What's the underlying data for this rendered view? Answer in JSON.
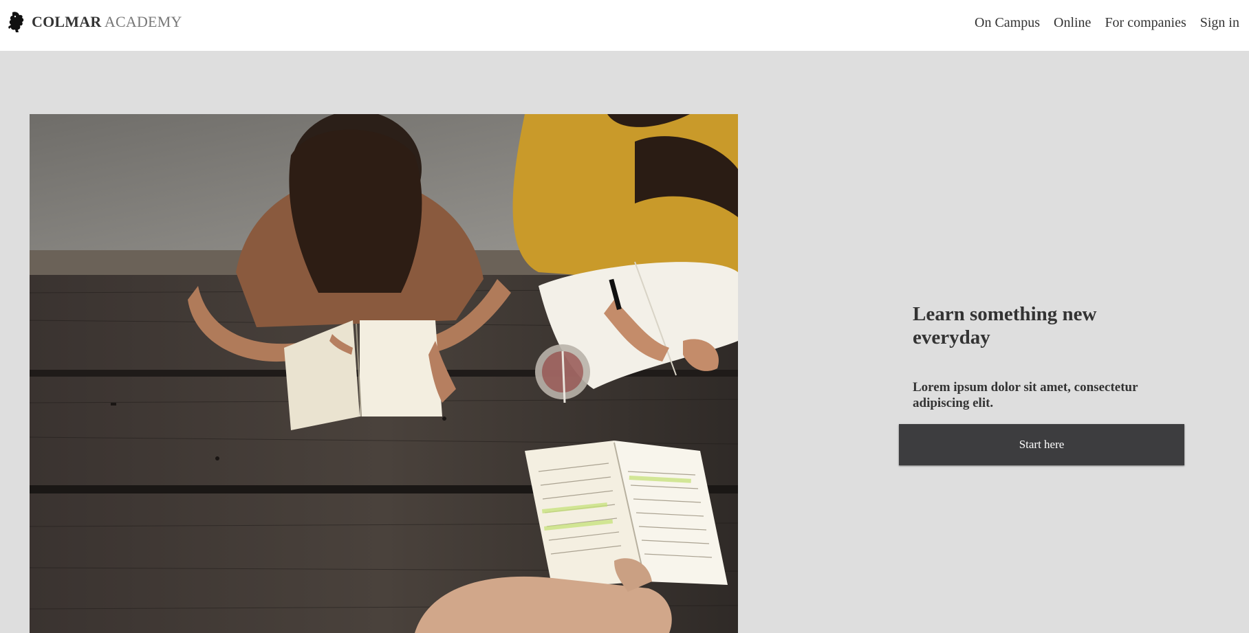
{
  "brand": {
    "name_strong": "COLMAR",
    "name_light": "ACADEMY",
    "logo_icon": "lion-rampant-icon"
  },
  "nav": {
    "items": [
      "On Campus",
      "Online",
      "For companies",
      "Sign in"
    ]
  },
  "hero": {
    "image_icon": "students-studying-photo",
    "heading": "Learn something new everyday",
    "subheading": "Lorem ipsum dolor sit amet, consectetur adipiscing elit.",
    "cta_label": "Start here"
  },
  "colors": {
    "header_bg": "#ffffff",
    "page_bg": "#dedede",
    "button_bg": "#3d3d3f",
    "text": "#333333"
  }
}
